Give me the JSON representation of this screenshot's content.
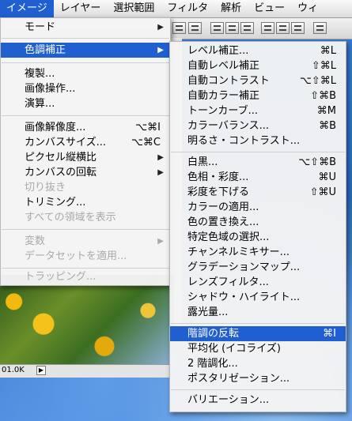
{
  "menubar": {
    "items": [
      {
        "label": "イメージ"
      },
      {
        "label": "レイヤー"
      },
      {
        "label": "選択範囲"
      },
      {
        "label": "フィルタ"
      },
      {
        "label": "解析"
      },
      {
        "label": "ビュー"
      },
      {
        "label": "ウィ"
      }
    ]
  },
  "status": {
    "size": "01.0K",
    "arrow": "▶"
  },
  "image_menu": {
    "mode": "モード",
    "adjust": "色調補正",
    "duplicate": "複製...",
    "apply_image": "画像操作...",
    "calculations": "演算...",
    "image_size": "画像解像度...",
    "image_size_sc": "⌥⌘I",
    "canvas_size": "カンバスサイズ...",
    "canvas_size_sc": "⌥⌘C",
    "pixel_aspect": "ピクセル縦横比",
    "rotate_canvas": "カンバスの回転",
    "crop": "切り抜き",
    "trim": "トリミング...",
    "reveal_all": "すべての領域を表示",
    "variables": "変数",
    "apply_dataset": "データセットを適用...",
    "trap": "トラッピング..."
  },
  "adjust_menu": {
    "levels": "レベル補正...",
    "levels_sc": "⌘L",
    "auto_levels": "自動レベル補正",
    "auto_levels_sc": "⇧⌘L",
    "auto_contrast": "自動コントラスト",
    "auto_contrast_sc": "⌥⇧⌘L",
    "auto_color": "自動カラー補正",
    "auto_color_sc": "⇧⌘B",
    "curves": "トーンカーブ...",
    "curves_sc": "⌘M",
    "color_balance": "カラーバランス...",
    "color_balance_sc": "⌘B",
    "brightness": "明るさ・コントラスト...",
    "bw": "白黒...",
    "bw_sc": "⌥⇧⌘B",
    "hue_sat": "色相・彩度...",
    "hue_sat_sc": "⌘U",
    "desaturate": "彩度を下げる",
    "desaturate_sc": "⇧⌘U",
    "match_color": "カラーの適用...",
    "replace_color": "色の置き換え...",
    "selective_color": "特定色域の選択...",
    "channel_mixer": "チャンネルミキサー...",
    "gradient_map": "グラデーションマップ...",
    "photo_filter": "レンズフィルタ...",
    "shadow_highlight": "シャドウ・ハイライト...",
    "exposure": "露光量...",
    "invert": "階調の反転",
    "invert_sc": "⌘I",
    "equalize": "平均化 (イコライズ)",
    "threshold": "2 階調化...",
    "posterize": "ポスタリゼーション...",
    "variations": "バリエーション..."
  }
}
